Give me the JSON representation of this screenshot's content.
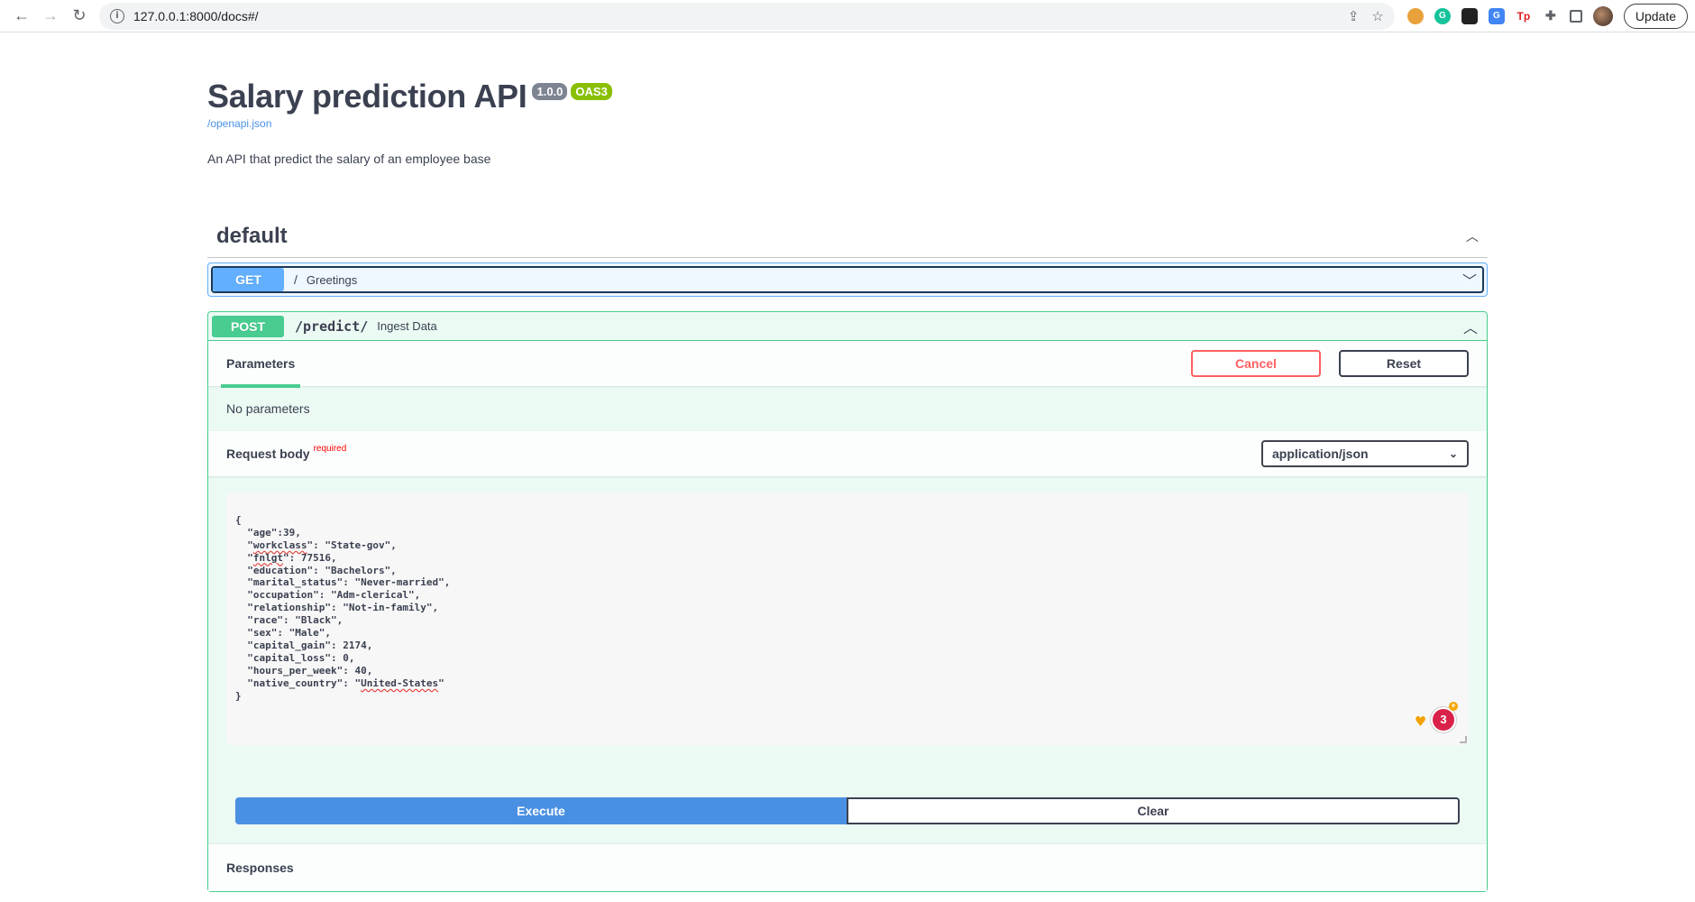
{
  "browser": {
    "url": "127.0.0.1:8000/docs#/",
    "update_label": "Update"
  },
  "info": {
    "title": "Salary prediction API",
    "version": "1.0.0",
    "oas": "OAS3",
    "spec_link": "/openapi.json",
    "description": "An API that predict the salary of an employee base"
  },
  "tag": {
    "name": "default"
  },
  "operations": {
    "get": {
      "method": "GET",
      "path": "/",
      "summary": "Greetings"
    },
    "post": {
      "method": "POST",
      "path": "/predict/",
      "summary": "Ingest Data",
      "tab": "Parameters",
      "cancel_label": "Cancel",
      "reset_label": "Reset",
      "no_params": "No parameters",
      "request_body_label": "Request body",
      "required_label": "required",
      "content_type": "application/json",
      "body_lines": [
        "{",
        "  \"age\":39,",
        "  \"workclass\": \"State-gov\",",
        "  \"fnlgt\": 77516,",
        "  \"education\": \"Bachelors\",",
        "  \"marital_status\": \"Never-married\",",
        "  \"occupation\": \"Adm-clerical\",",
        "  \"relationship\": \"Not-in-family\",",
        "  \"race\": \"Black\",",
        "  \"sex\": \"Male\",",
        "  \"capital_gain\": 2174,",
        "  \"capital_loss\": 0,",
        "  \"hours_per_week\": 40,",
        "  \"native_country\": \"United-States\"",
        "}"
      ],
      "grammarly_count": "3",
      "execute_label": "Execute",
      "clear_label": "Clear",
      "responses_label": "Responses"
    }
  },
  "colors": {
    "get": "#61affe",
    "post": "#49cc90",
    "cancel": "#ff6060",
    "execute": "#4990e2"
  }
}
